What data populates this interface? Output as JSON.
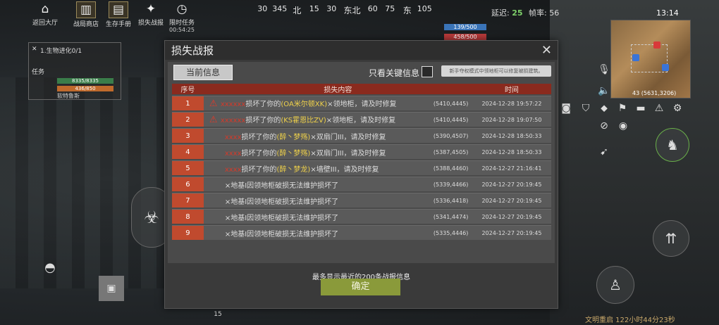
{
  "hud": {
    "buttons": [
      {
        "label": "返回大厅",
        "icon": "home-icon"
      },
      {
        "label": "战局商店",
        "icon": "shop-icon"
      },
      {
        "label": "生存手册",
        "icon": "book-icon"
      },
      {
        "label": "损失战报",
        "icon": "battle-report-icon"
      },
      {
        "label": "限时任务",
        "icon": "timer-icon"
      }
    ],
    "timer": "00:54:25",
    "latency_label": "延迟:",
    "latency_value": "25",
    "fps_label": "帧率:",
    "fps_value": "56",
    "clock": "13:14",
    "countdown": "文明重启 122小时44分23秒",
    "bottom_num": "15"
  },
  "compass": [
    "30",
    "345",
    "北",
    "15",
    "30",
    "东北",
    "60",
    "75",
    "东",
    "105"
  ],
  "resources": [
    {
      "value": "139/500",
      "color": "#3a74b8"
    },
    {
      "value": "458/500",
      "color": "#b83a3a"
    }
  ],
  "task_panel": {
    "title": "1.生物进化0/1",
    "label": "任务",
    "hp": "8335/8335",
    "mp": "436/850",
    "name": "软特鲁斯"
  },
  "minimap": {
    "coords": "(5631,3206)",
    "level": "43"
  },
  "dialog": {
    "title": "损失战报",
    "tab_current": "当前信息",
    "key_only_label": "只看关键信息",
    "tip": "新手夺权模式中领地柜可以修复被损建筑。",
    "headers": {
      "no": "序号",
      "content": "损失内容",
      "time": "时间"
    },
    "rows": [
      {
        "no": "1",
        "warn": true,
        "actor": "xxxxxx",
        "pre": "损坏了你的",
        "target": "(OA米尔顿XK)",
        "post": "×领地柜，请及时修复",
        "coord": "(5410,4445)",
        "time": "2024-12-28 19:57:22"
      },
      {
        "no": "2",
        "warn": true,
        "actor": "xxxxxx",
        "pre": "损坏了你的",
        "target": "(KS霍恩比ZV)",
        "post": "×领地柜，请及时修复",
        "coord": "(5410,4445)",
        "time": "2024-12-28 19:07:50"
      },
      {
        "no": "3",
        "warn": false,
        "actor": "xxxx",
        "pre": "损坏了你的",
        "target": "(醉丶梦殇)",
        "post": "×双扇门III，请及时修复",
        "coord": "(5390,4507)",
        "time": "2024-12-28 18:50:33"
      },
      {
        "no": "4",
        "warn": false,
        "actor": "xxxx",
        "pre": "损坏了你的",
        "target": "(醉丶梦殇)",
        "post": "×双扇门III，请及时修复",
        "coord": "(5387,4505)",
        "time": "2024-12-28 18:50:33"
      },
      {
        "no": "5",
        "warn": false,
        "actor": "xxxx",
        "pre": "损坏了你的",
        "target": "(醉丶梦龙)",
        "post": "×墙壁III，请及时修复",
        "coord": "(5388,4460)",
        "time": "2024-12-27 21:16:41"
      },
      {
        "no": "6",
        "warn": false,
        "actor": "",
        "pre": "",
        "target": "",
        "post": "×地基I因领地柜破损无法维护损坏了",
        "coord": "(5339,4466)",
        "time": "2024-12-27 20:19:45"
      },
      {
        "no": "7",
        "warn": false,
        "actor": "",
        "pre": "",
        "target": "",
        "post": "×地基I因领地柜破损无法维护损坏了",
        "coord": "(5336,4418)",
        "time": "2024-12-27 20:19:45"
      },
      {
        "no": "8",
        "warn": false,
        "actor": "",
        "pre": "",
        "target": "",
        "post": "×地基I因领地柜破损无法维护损坏了",
        "coord": "(5341,4474)",
        "time": "2024-12-27 20:19:45"
      },
      {
        "no": "9",
        "warn": false,
        "actor": "",
        "pre": "",
        "target": "",
        "post": "×地基I因领地柜破损无法维护损坏了",
        "coord": "(5335,4446)",
        "time": "2024-12-27 20:19:45"
      }
    ],
    "footer_note": "最多显示最近的200条战报信息",
    "confirm": "确定"
  }
}
